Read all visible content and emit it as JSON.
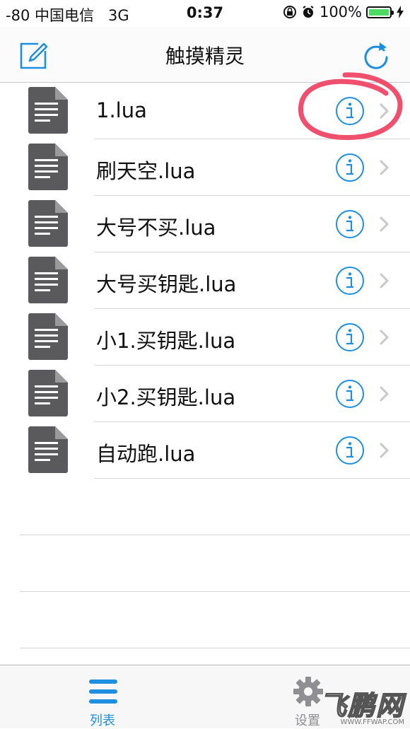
{
  "status_bar": {
    "carrier": "-80 中国电信",
    "network": "3G",
    "time": "0:37",
    "battery_percent": "100%",
    "battery_level": 1.0
  },
  "nav": {
    "title": "触摸精灵",
    "edit_icon": "compose-icon",
    "refresh_icon": "refresh-icon"
  },
  "files": [
    {
      "name": "1.lua"
    },
    {
      "name": "刷天空.lua"
    },
    {
      "name": "大号不买.lua"
    },
    {
      "name": "大号买钥匙.lua"
    },
    {
      "name": "小1.买钥匙.lua"
    },
    {
      "name": "小2.买钥匙.lua"
    },
    {
      "name": "自动跑.lua"
    }
  ],
  "tabs": [
    {
      "label": "列表",
      "icon": "list-icon",
      "selected": true
    },
    {
      "label": "设置",
      "icon": "gear-icon",
      "selected": false
    }
  ],
  "watermark": {
    "main": "飞鹏网",
    "sub": "WWW.FFWAP.COM"
  },
  "colors": {
    "accent": "#1e8fe0",
    "highlight": "#f0506e",
    "file_icon": "#5a5a5c",
    "battery": "#4cd964"
  }
}
